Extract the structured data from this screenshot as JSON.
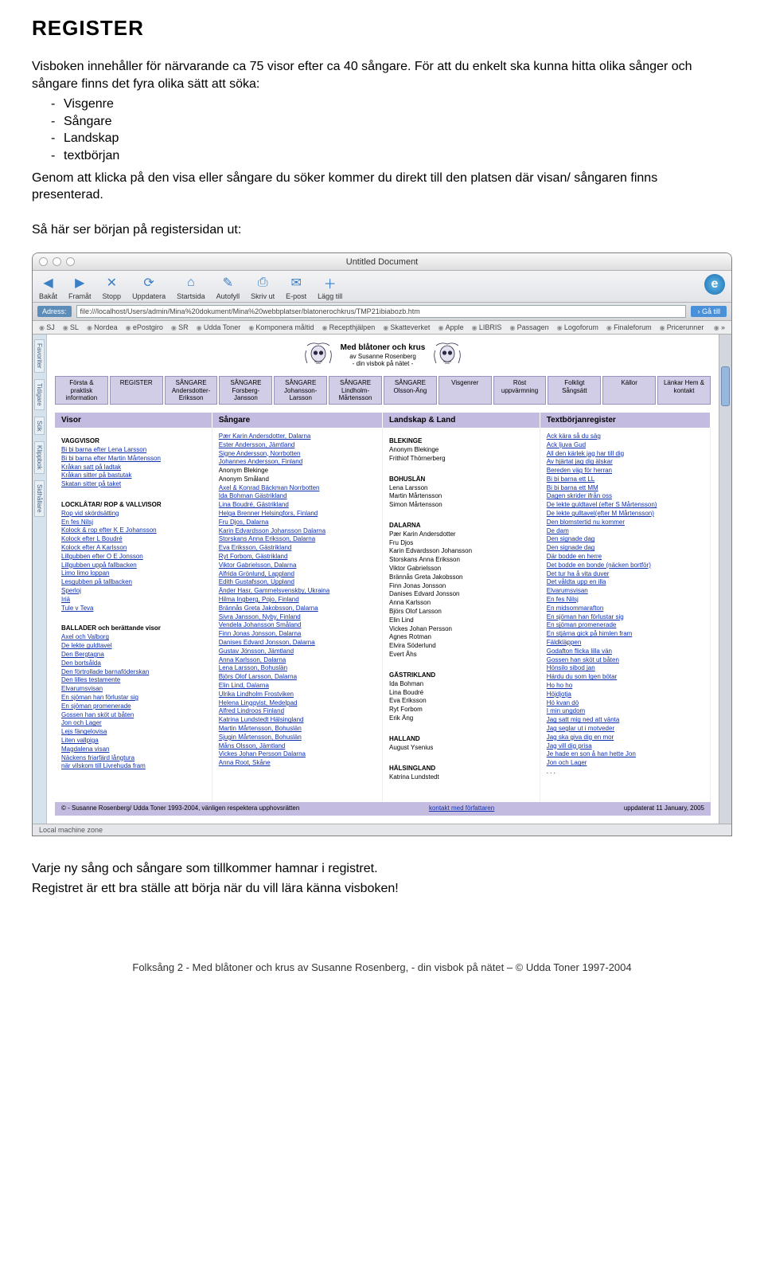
{
  "title": "REGISTER",
  "intro": {
    "p1": "Visboken innehåller för närvarande ca 75 visor efter ca 40 sångare. För att du enkelt ska kunna hitta olika sånger och sångare finns det fyra olika sätt att söka:",
    "criteria": [
      "Visgenre",
      "Sångare",
      "Landskap",
      "textbörjan"
    ],
    "p2": "Genom att klicka på den visa eller sångare du söker kommer du direkt till den platsen där visan/ sångaren finns presenterad.",
    "p3": "Så här ser början på registersidan ut:"
  },
  "browser": {
    "windowTitle": "Untitled Document",
    "toolbar": [
      {
        "icon": "◀",
        "label": "Bakåt"
      },
      {
        "icon": "▶",
        "label": "Framåt"
      },
      {
        "icon": "✕",
        "label": "Stopp"
      },
      {
        "icon": "⟳",
        "label": "Uppdatera"
      },
      {
        "icon": "⌂",
        "label": "Startsida"
      },
      {
        "icon": "✎",
        "label": "Autofyll"
      },
      {
        "icon": "⎙",
        "label": "Skriv ut"
      },
      {
        "icon": "✉",
        "label": "E-post"
      },
      {
        "icon": "＋",
        "label": "Lägg till"
      }
    ],
    "addressLabel": "Adress:",
    "addressValue": "file:///localhost/Users/admin/Mina%20dokument/Mina%20webbplatser/blatonerochkrus/TMP21ibiabozb.htm",
    "goLabel": "› Gå till",
    "favorites": [
      "SJ",
      "SL",
      "Nordea",
      "ePostgiro",
      "SR",
      "Udda Toner",
      "Komponera måltid",
      "Recepthjälpen",
      "Skatteverket",
      "Apple",
      "LIBRIS",
      "Passagen",
      "Logoforum",
      "Finaleforum",
      "Pricerunner"
    ],
    "sideTabs": [
      "Favoriter",
      "Tidigare",
      "Sök",
      "Klippbok",
      "Sidhållare"
    ],
    "statusBar": "Local machine zone"
  },
  "siteHeader": {
    "title": "Med blåtoner och krus",
    "byline": "av Susanne Rosenberg",
    "sub": "- din visbok på nätet -"
  },
  "navCells": [
    "Första & praktisk information",
    "REGISTER",
    "SÅNGARE Andersdotter-Eriksson",
    "SÅNGARE Forsberg-Jansson",
    "SÅNGARE Johansson-Larsson",
    "SÅNGARE Lindholm-Mårtensson",
    "SÅNGARE Olsson-Äng",
    "Visgenrer",
    "Röst uppvärmning",
    "Folkligt Sångsätt",
    "Källor",
    "Länkar Hem & kontakt"
  ],
  "colHeaders": {
    "c1": "Visor",
    "c2": "Sångare",
    "c3": "Landskap & Land",
    "c4": "Textbörjanregister"
  },
  "col1": {
    "g1": "VAGGVISOR",
    "g1items": [
      "Bi bi barna efter Lena Larsson",
      "Bi bi barna efter Martin Mårtensson",
      "Kråkan satt på ladtak",
      "Kråkan sitter på bastutak",
      "Skatan sitter på taket"
    ],
    "g2": "LOCKLÅTAR/ ROP & VALLVISOR",
    "g2items": [
      "Rop vid skördsätting",
      "En fes Nilsj",
      "Kolock & rop efter K E Johansson",
      "Kolock efter L Boudré",
      "Kolock efter A Karlsson",
      "Lillgubben efter O E Jonsson",
      "Lillgubben uppå fallbacken",
      "Limo limo loppan",
      "Lesgubben på tallbacken",
      "Sperloj",
      "Iriä",
      "Tule v Teva"
    ],
    "g3": "BALLADER och berättande visor",
    "g3items": [
      "Axel och Valborg",
      "De lekte guldtavel",
      "Den Bergtagna",
      "Den bortsålda",
      "Den förtrollade barnaföderskan",
      "Den lilles testamente",
      "Elvarumsvisan",
      "En sjöman han förlustar sig",
      "En sjöman promenerade",
      "Gossen han sköt ut båten",
      "Jon och Lager",
      "Lejs fängelovisa",
      "Liten vallpiga",
      "Magdalena visan",
      "Näckens friarfärd långtura",
      "när vilskom till Livrehuda fram"
    ],
    "dots": ""
  },
  "col2": {
    "items1": [
      "Pær Karin Andersdotter, Dalarna",
      "Ester Andersson, Jämtland",
      "Signe Andersson, Norrbotten",
      "Johannes Andersson, Finland"
    ],
    "p1": "Anonym Blekinge",
    "p2": "Anonym Småland",
    "items2": [
      "Axel & Konrad Bäckman Norrbotten",
      "Ida Bohman Gästrikland",
      "Lina Boudré, Gästrikland",
      "Helga Brenner Helsingfors, Finland",
      "Fru Djos, Dalarna",
      "Karin Edvardsson Johansson Dalarna",
      "Storskans Anna Eriksson, Dalarna",
      "Eva Eriksson, Gästrikland",
      "Ryt Forbom, Gästrikland",
      "Viktor Gabrielsson, Dalarna",
      "Alfrida Grönlund, Lappland",
      "Edith Gustafsson, Uppland",
      "Änder Hasr, Gammelsvenskby, Ukraina",
      "Hilma Ingberg, Pojo, Finland",
      "Brännås Greta Jakobsson, Dalarna",
      "Sivra Jansson, Nyby, Finland",
      "Vendela Johansson Småland",
      "Finn Jonas Jonsson, Dalarna",
      "Danises Edvard Jonsson, Dalarna",
      "Gustav Jönsson, Jämtland",
      "Anna Karlsson, Dalarna",
      "Lena Larsson, Bohuslän",
      "Björs Olof Larsson, Dalarna",
      "Elin Lind, Dalarna",
      "Ulrika Lindholm Frostviken",
      "Helena Lingqvist, Medelpad",
      "Alfred Lindroos Finland",
      "Katrina Lundstedt Hälsingland",
      "Martin Mårtensson, Bohuslän",
      "Sjugin Mårtensson, Bohuslän",
      "Måns Olsson, Jämtland",
      "Vickes Johan Persson Dalarna",
      "Anna Root, Skåne"
    ]
  },
  "col3": {
    "g1": "BLEKINGE",
    "g1items": [
      "Anonym Blekinge",
      "Frithiof Thörnerberg"
    ],
    "g2": "BOHUSLÄN",
    "g2items": [
      "Lena Larsson",
      "Martin Mårtensson",
      "Simon Mårtensson"
    ],
    "g3": "DALARNA",
    "g3items": [
      "Pær Karin Andersdotter",
      "Fru Djos",
      "Karin Edvardsson Johansson",
      "Storskans Anna Eriksson",
      "Viktor Gabrielsson",
      "Brännås Greta Jakobsson",
      "Finn Jonas Jonsson",
      "Danises Edvard Jonsson",
      "Anna Karlsson",
      "Björs Olof Larsson",
      "Elin Lind",
      "Vickes Johan Persson",
      "Agnes Rotman",
      "Elvira Söderlund",
      "Evert Åhs"
    ],
    "g4": "GÄSTRIKLAND",
    "g4items": [
      "Ida Bohman",
      "Lina Boudré",
      "Eva Eriksson",
      "Ryt Forbom",
      "Erik Äng"
    ],
    "g5": "HALLAND",
    "g5items": [
      "August Ysenius"
    ],
    "g6": "HÄLSINGLAND",
    "g6items": [
      "Katrina Lundstedt"
    ]
  },
  "col4": {
    "items": [
      "Ack kära så du säg",
      "Ack ljuva Gud",
      "All den kärlek jag har till dig",
      "Av hjärtat jag dig älskar",
      "Bereden väg för herran",
      "Bi bi barna ett LL",
      "Bi bi barna ett MM",
      "Dagen skrider ifrån oss",
      "De lekte guldtavel (efter S Mårtensson)",
      "De lekte gulltavel(efter M Mårtensson)",
      "Den blomstertid nu kommer",
      "De dam",
      "Den signade dag",
      "Den signade dag",
      "Där bodde en herre",
      "Det bodde en bonde (näcken bortför)",
      "Det tur ha å vita duver",
      "Det våldta upp en illa",
      "Elvarumsvisan",
      "En fes Nilsj",
      "En midsommarafton",
      "En sjöman han förlustar sig",
      "En sjöman promenerade",
      "En stjärna gick på himlen fram",
      "Fäldkläppen",
      "Godafton flicka lilla vän",
      "Gossen han sköt ut båten",
      "Hönsilo sibod jan",
      "Härdu du som Igen bötar",
      "Ho ho ho",
      "Höjdjotja",
      "Hö kvan dö",
      "I min ungdom",
      "Jag satt mig ned att vänta",
      "Jag seglar ut i motveder",
      "Jag ska giva dig en mor",
      "Jag vill dig prisa",
      "Je hade en son å han hette Jon",
      "Jon och Lager"
    ],
    "dots": ". . ."
  },
  "footbar": {
    "left": "© - Susanne Rosenberg/ Udda Toner 1993-2004, vänligen respektera upphovsrätten",
    "mid": "kontakt med författaren",
    "right": "uppdaterat 11 January, 2005"
  },
  "after": {
    "p1": "Varje ny sång och sångare som tillkommer hamnar i registret.",
    "p2": "Registret är ett bra ställe att börja när du vill lära känna visboken!"
  },
  "footer": "Folksång 2 - Med blåtoner och krus av Susanne Rosenberg, - din visbok på nätet –  © Udda Toner 1997-2004"
}
